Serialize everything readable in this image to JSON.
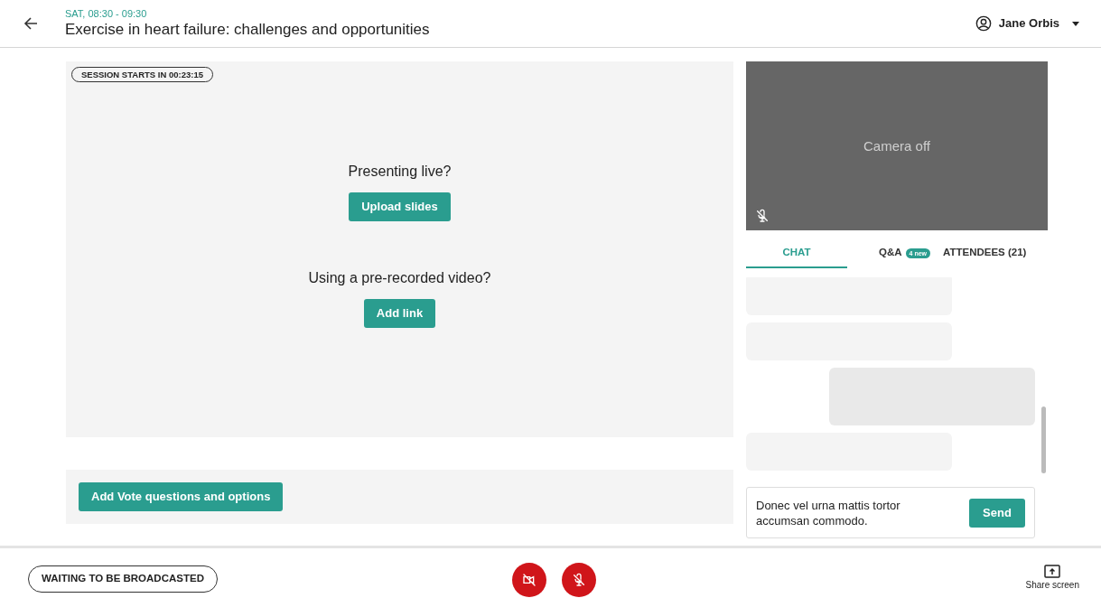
{
  "header": {
    "time": "SAT, 08:30 - 09:30",
    "title": "Exercise in heart failure: challenges and opportunities",
    "user": "Jane Orbis"
  },
  "stage": {
    "countdown": "SESSION STARTS IN 00:23:15",
    "sections": [
      {
        "prompt": "Presenting live?",
        "button": "Upload slides"
      },
      {
        "prompt": "Using a pre-recorded video?",
        "button": "Add link"
      }
    ]
  },
  "vote": {
    "button": "Add Vote questions and options"
  },
  "camera": {
    "status": "Camera off",
    "mic_muted": true
  },
  "tabs": [
    {
      "label": "CHAT",
      "selected": true
    },
    {
      "label": "Q&A",
      "badge": "4 new",
      "selected": false
    },
    {
      "label": "ATTENDEES (21)",
      "selected": false
    }
  ],
  "chat_messages": [
    {
      "kind": "received"
    },
    {
      "kind": "received"
    },
    {
      "kind": "sent"
    },
    {
      "kind": "received"
    }
  ],
  "composer": {
    "value": "Donec vel urna mattis tortor accumsan commodo.",
    "button": "Send"
  },
  "footer": {
    "status": "WAITING TO BE BROADCASTED",
    "camera_on": false,
    "mic_on": false,
    "share": "Share screen"
  }
}
